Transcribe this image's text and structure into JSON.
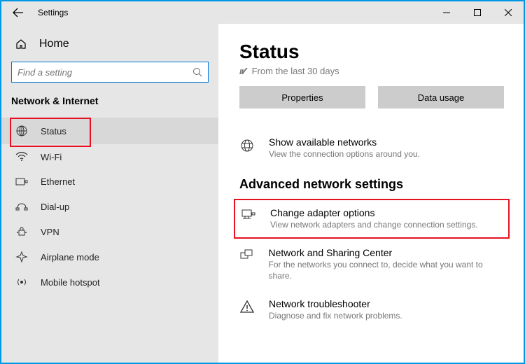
{
  "titlebar": {
    "title": "Settings"
  },
  "sidebar": {
    "home": "Home",
    "search_placeholder": "Find a setting",
    "section": "Network & Internet",
    "items": [
      {
        "label": "Status"
      },
      {
        "label": "Wi-Fi"
      },
      {
        "label": "Ethernet"
      },
      {
        "label": "Dial-up"
      },
      {
        "label": "VPN"
      },
      {
        "label": "Airplane mode"
      },
      {
        "label": "Mobile hotspot"
      }
    ]
  },
  "main": {
    "title": "Status",
    "from_text": "From the last 30 days",
    "btn_properties": "Properties",
    "btn_datausage": "Data usage",
    "show_networks": {
      "title": "Show available networks",
      "desc": "View the connection options around you."
    },
    "advanced_heading": "Advanced network settings",
    "adapter": {
      "title": "Change adapter options",
      "desc": "View network adapters and change connection settings."
    },
    "sharing": {
      "title": "Network and Sharing Center",
      "desc": "For the networks you connect to, decide what you want to share."
    },
    "troubleshooter": {
      "title": "Network troubleshooter",
      "desc": "Diagnose and fix network problems."
    }
  }
}
